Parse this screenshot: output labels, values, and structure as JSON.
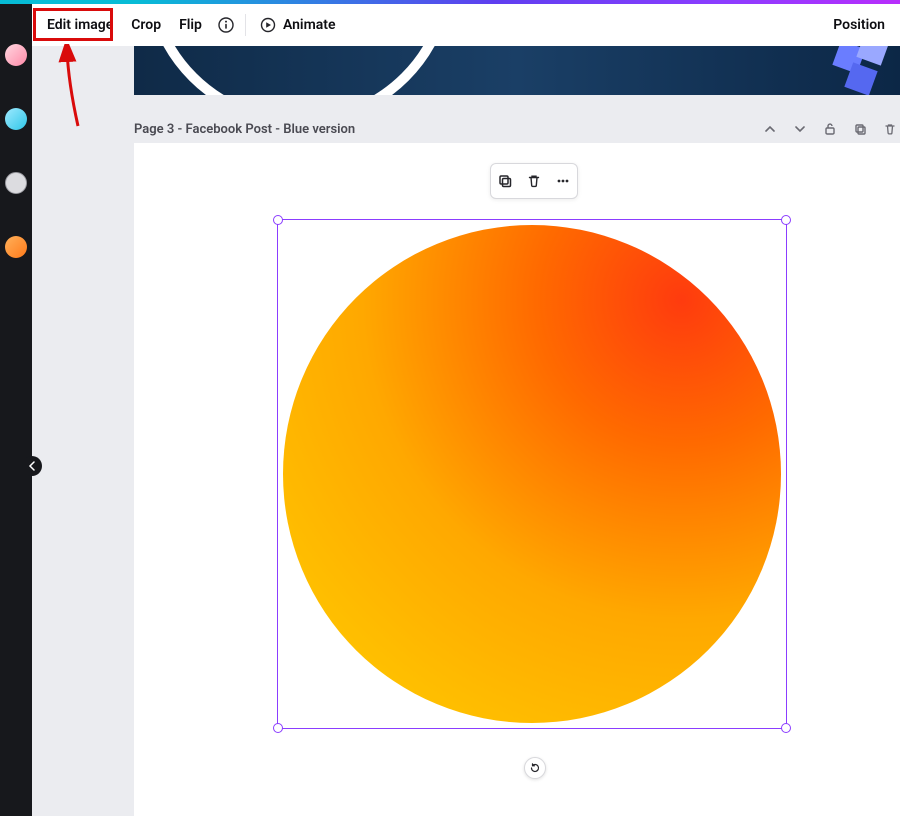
{
  "toolbar": {
    "edit_image": "Edit image",
    "crop": "Crop",
    "flip": "Flip",
    "animate": "Animate",
    "position": "Position"
  },
  "page_header": {
    "label": "Page 3 - Facebook Post - Blue version"
  },
  "rail": {
    "thumbs": [
      {
        "color_a": "#ffd7e0",
        "color_b": "#ff8aa8"
      },
      {
        "color_a": "#9fe9ff",
        "color_b": "#2fc7e8"
      },
      {
        "color_a": "#dcdce0",
        "color_b": "#bcbcc2"
      },
      {
        "color_a": "#ffb05a",
        "color_b": "#ff7a1a"
      }
    ]
  },
  "selected_element": {
    "kind": "gradient-circle",
    "gradient_from": "#ff3b0e",
    "gradient_to": "#ffcf00"
  },
  "annotation": {
    "target": "edit-image-button"
  }
}
